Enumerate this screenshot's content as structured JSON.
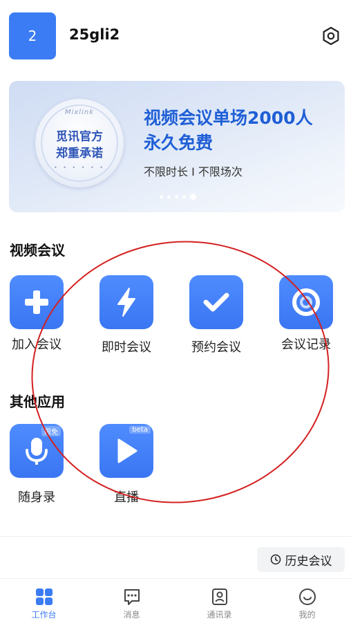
{
  "header": {
    "avatar_text": "2",
    "username": "25gli2",
    "settings_icon": "settings-hex-icon"
  },
  "banner": {
    "seal_top": "Mixlink",
    "seal_line1": "觅讯官方",
    "seal_line2": "郑重承诺",
    "seal_dots": "• • • • • •",
    "title_line1": "视频会议单场2000人",
    "title_line2": "永久免费",
    "subtitle": "不限时长 I 不限场次",
    "carousel_dots": 5,
    "active_dot": 4
  },
  "video_meeting": {
    "title": "视频会议",
    "apps": [
      {
        "label": "加入会议",
        "icon": "plus-icon"
      },
      {
        "label": "即时会议",
        "icon": "lightning-icon"
      },
      {
        "label": "预约会议",
        "icon": "checkmark-icon"
      },
      {
        "label": "会议记录",
        "icon": "record-target-icon"
      }
    ]
  },
  "other_apps": {
    "title": "其他应用",
    "apps": [
      {
        "label": "随身录",
        "icon": "microphone-icon",
        "tag": "限免"
      },
      {
        "label": "直播",
        "icon": "play-icon",
        "tag": "beta"
      }
    ]
  },
  "history_button": {
    "label": "历史会议",
    "icon": "clock-icon"
  },
  "tabbar": {
    "tabs": [
      {
        "label": "工作台",
        "icon": "grid-icon",
        "active": true
      },
      {
        "label": "消息",
        "icon": "chat-bubble-icon",
        "active": false
      },
      {
        "label": "通讯录",
        "icon": "contact-card-icon",
        "active": false
      },
      {
        "label": "我的",
        "icon": "smile-face-icon",
        "active": false
      }
    ]
  },
  "colors": {
    "accent": "#3b7cf5",
    "banner_title": "#1f5fd6",
    "annotation_circle": "#d42020"
  }
}
